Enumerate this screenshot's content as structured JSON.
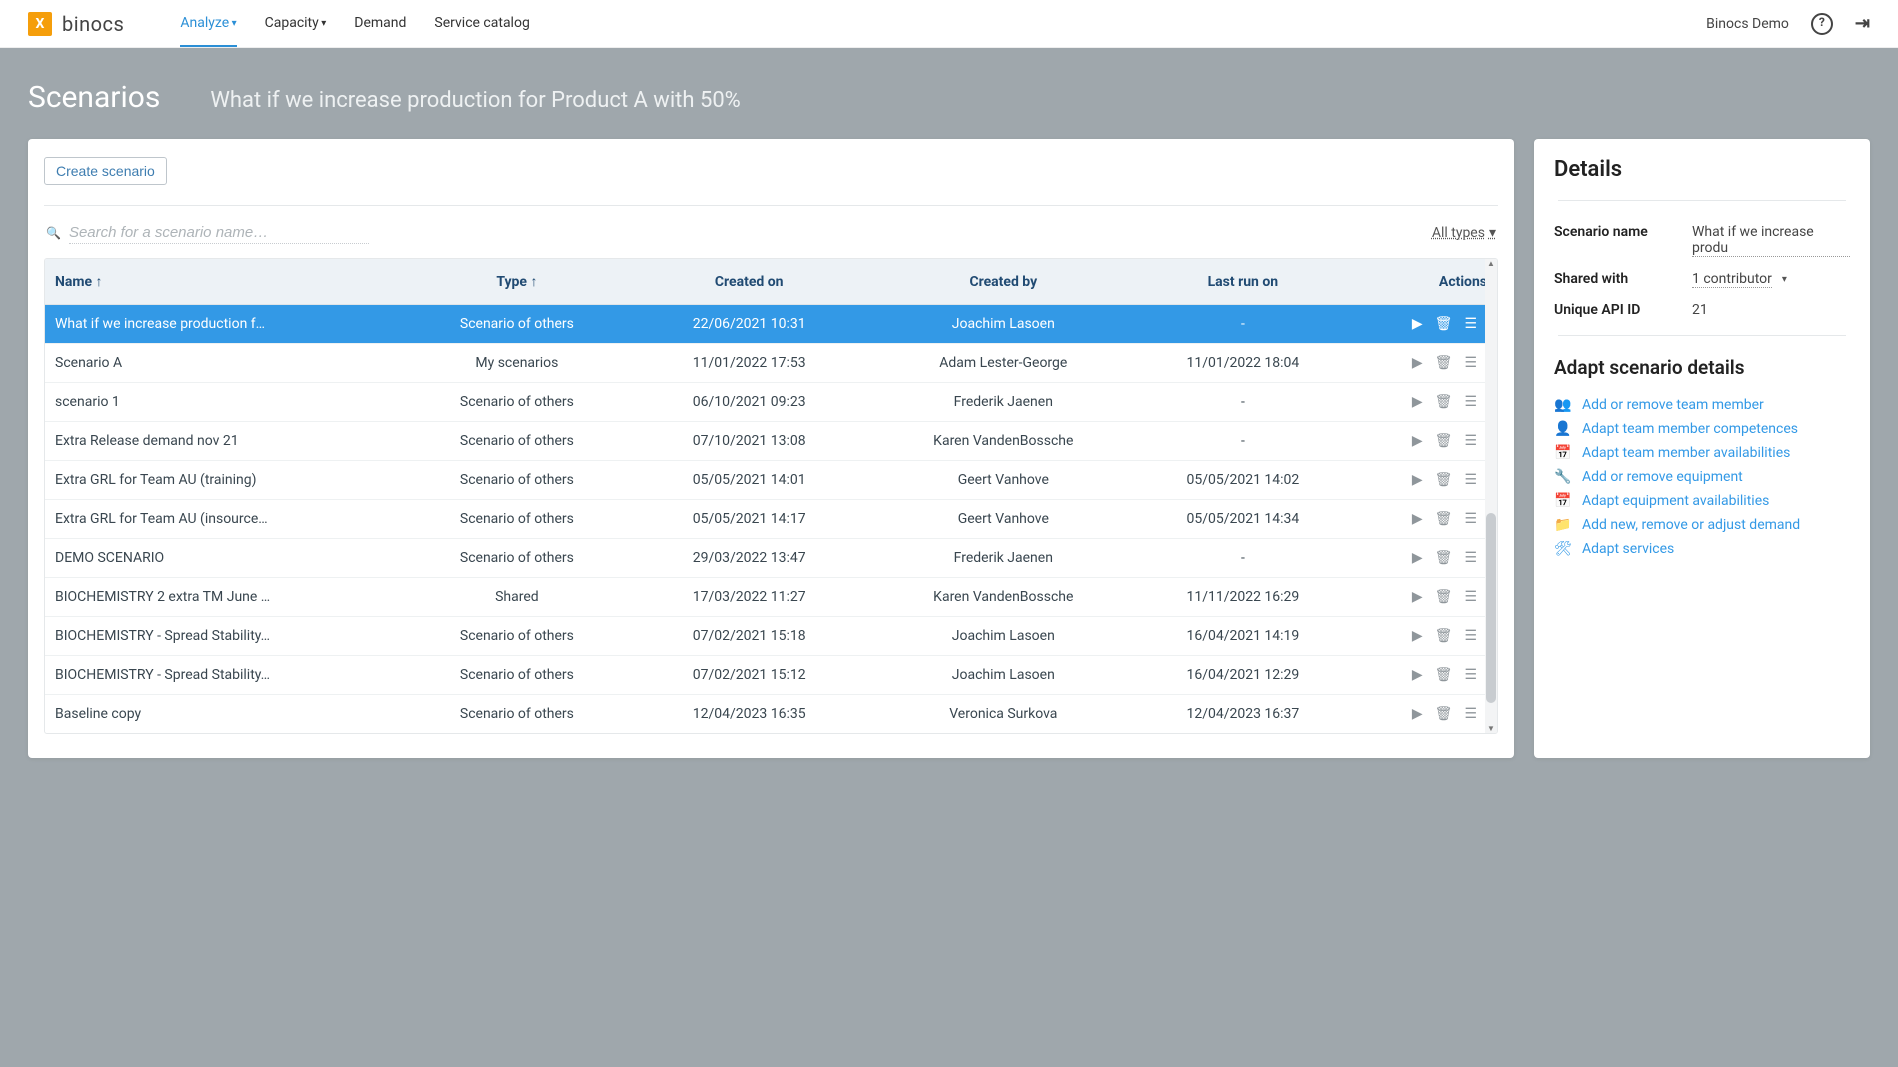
{
  "app": {
    "brand": "binocs",
    "logoLetter": "X"
  },
  "nav": {
    "items": [
      {
        "label": "Analyze",
        "active": true,
        "hasCaret": true
      },
      {
        "label": "Capacity",
        "active": false,
        "hasCaret": true
      },
      {
        "label": "Demand",
        "active": false,
        "hasCaret": false
      },
      {
        "label": "Service catalog",
        "active": false,
        "hasCaret": false
      }
    ]
  },
  "topright": {
    "user": "Binocs Demo"
  },
  "header": {
    "title": "Scenarios",
    "subtitle": "What if we increase production for Product A with 50%"
  },
  "toolbar": {
    "createLabel": "Create scenario",
    "searchPlaceholder": "Search for a scenario name…",
    "filterLabel": "All types"
  },
  "columns": {
    "name": "Name",
    "type": "Type",
    "createdOn": "Created on",
    "createdBy": "Created by",
    "lastRun": "Last run on",
    "actions": "Actions"
  },
  "rows": [
    {
      "name": "What if we increase production f…",
      "type": "Scenario of others",
      "createdOn": "22/06/2021 10:31",
      "createdBy": "Joachim Lasoen",
      "lastRun": "-",
      "selected": true
    },
    {
      "name": "Scenario A",
      "type": "My scenarios",
      "createdOn": "11/01/2022 17:53",
      "createdBy": "Adam Lester-George",
      "lastRun": "11/01/2022 18:04",
      "selected": false
    },
    {
      "name": "scenario 1",
      "type": "Scenario of others",
      "createdOn": "06/10/2021 09:23",
      "createdBy": "Frederik Jaenen",
      "lastRun": "-",
      "selected": false
    },
    {
      "name": "Extra Release demand nov 21",
      "type": "Scenario of others",
      "createdOn": "07/10/2021 13:08",
      "createdBy": "Karen VandenBossche",
      "lastRun": "-",
      "selected": false
    },
    {
      "name": "Extra GRL for Team AU (training)",
      "type": "Scenario of others",
      "createdOn": "05/05/2021 14:01",
      "createdBy": "Geert Vanhove",
      "lastRun": "05/05/2021 14:02",
      "selected": false
    },
    {
      "name": "Extra GRL for Team AU (insource…",
      "type": "Scenario of others",
      "createdOn": "05/05/2021 14:17",
      "createdBy": "Geert Vanhove",
      "lastRun": "05/05/2021 14:34",
      "selected": false
    },
    {
      "name": "DEMO SCENARIO",
      "type": "Scenario of others",
      "createdOn": "29/03/2022 13:47",
      "createdBy": "Frederik Jaenen",
      "lastRun": "-",
      "selected": false
    },
    {
      "name": "BIOCHEMISTRY 2 extra TM June …",
      "type": "Shared",
      "createdOn": "17/03/2022 11:27",
      "createdBy": "Karen VandenBossche",
      "lastRun": "11/11/2022 16:29",
      "selected": false
    },
    {
      "name": "BIOCHEMISTRY - Spread Stability…",
      "type": "Scenario of others",
      "createdOn": "07/02/2021 15:18",
      "createdBy": "Joachim Lasoen",
      "lastRun": "16/04/2021 14:19",
      "selected": false
    },
    {
      "name": "BIOCHEMISTRY - Spread Stability…",
      "type": "Scenario of others",
      "createdOn": "07/02/2021 15:12",
      "createdBy": "Joachim Lasoen",
      "lastRun": "16/04/2021 12:29",
      "selected": false
    },
    {
      "name": "Baseline copy",
      "type": "Scenario of others",
      "createdOn": "12/04/2023 16:35",
      "createdBy": "Veronica Surkova",
      "lastRun": "12/04/2023 16:37",
      "selected": false
    }
  ],
  "details": {
    "panelTitle": "Details",
    "labels": {
      "name": "Scenario name",
      "shared": "Shared with",
      "apiId": "Unique API ID"
    },
    "scenarioName": "What if we increase produ",
    "sharedWith": "1 contributor",
    "apiId": "21",
    "adaptHeading": "Adapt scenario details",
    "actions": [
      {
        "icon": "👥",
        "label": "Add or remove team member"
      },
      {
        "icon": "👤",
        "label": "Adapt team member competences"
      },
      {
        "icon": "📅",
        "label": "Adapt team member availabilities"
      },
      {
        "icon": "🔧",
        "label": "Add or remove equipment"
      },
      {
        "icon": "📅",
        "label": "Adapt equipment availabilities"
      },
      {
        "icon": "📁",
        "label": "Add new, remove or adjust demand"
      },
      {
        "icon": "🛠",
        "label": "Adapt services"
      }
    ]
  }
}
